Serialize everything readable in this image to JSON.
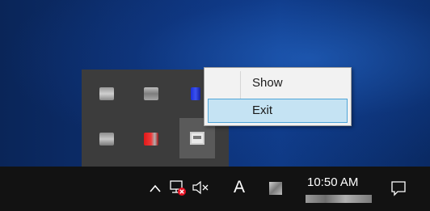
{
  "context_menu": {
    "items": [
      {
        "label": "Show"
      },
      {
        "label": "Exit"
      }
    ],
    "hover_color": "#c5e3f3",
    "hover_border": "#4fa5d8"
  },
  "overflow_tray": {
    "icons": [
      "blurred-app-icon",
      "blurred-app-icon",
      "blurred-blue-app-icon",
      "blurred-app-icon",
      "blurred-red-app-icon",
      "app-window-icon"
    ]
  },
  "taskbar": {
    "show_hidden_glyph": "^",
    "volume_glyph": "🔇",
    "ime_label": "A",
    "clock_time": "10:50 AM",
    "colors": {
      "background": "#121212",
      "panel": "#3c3c3c"
    }
  }
}
